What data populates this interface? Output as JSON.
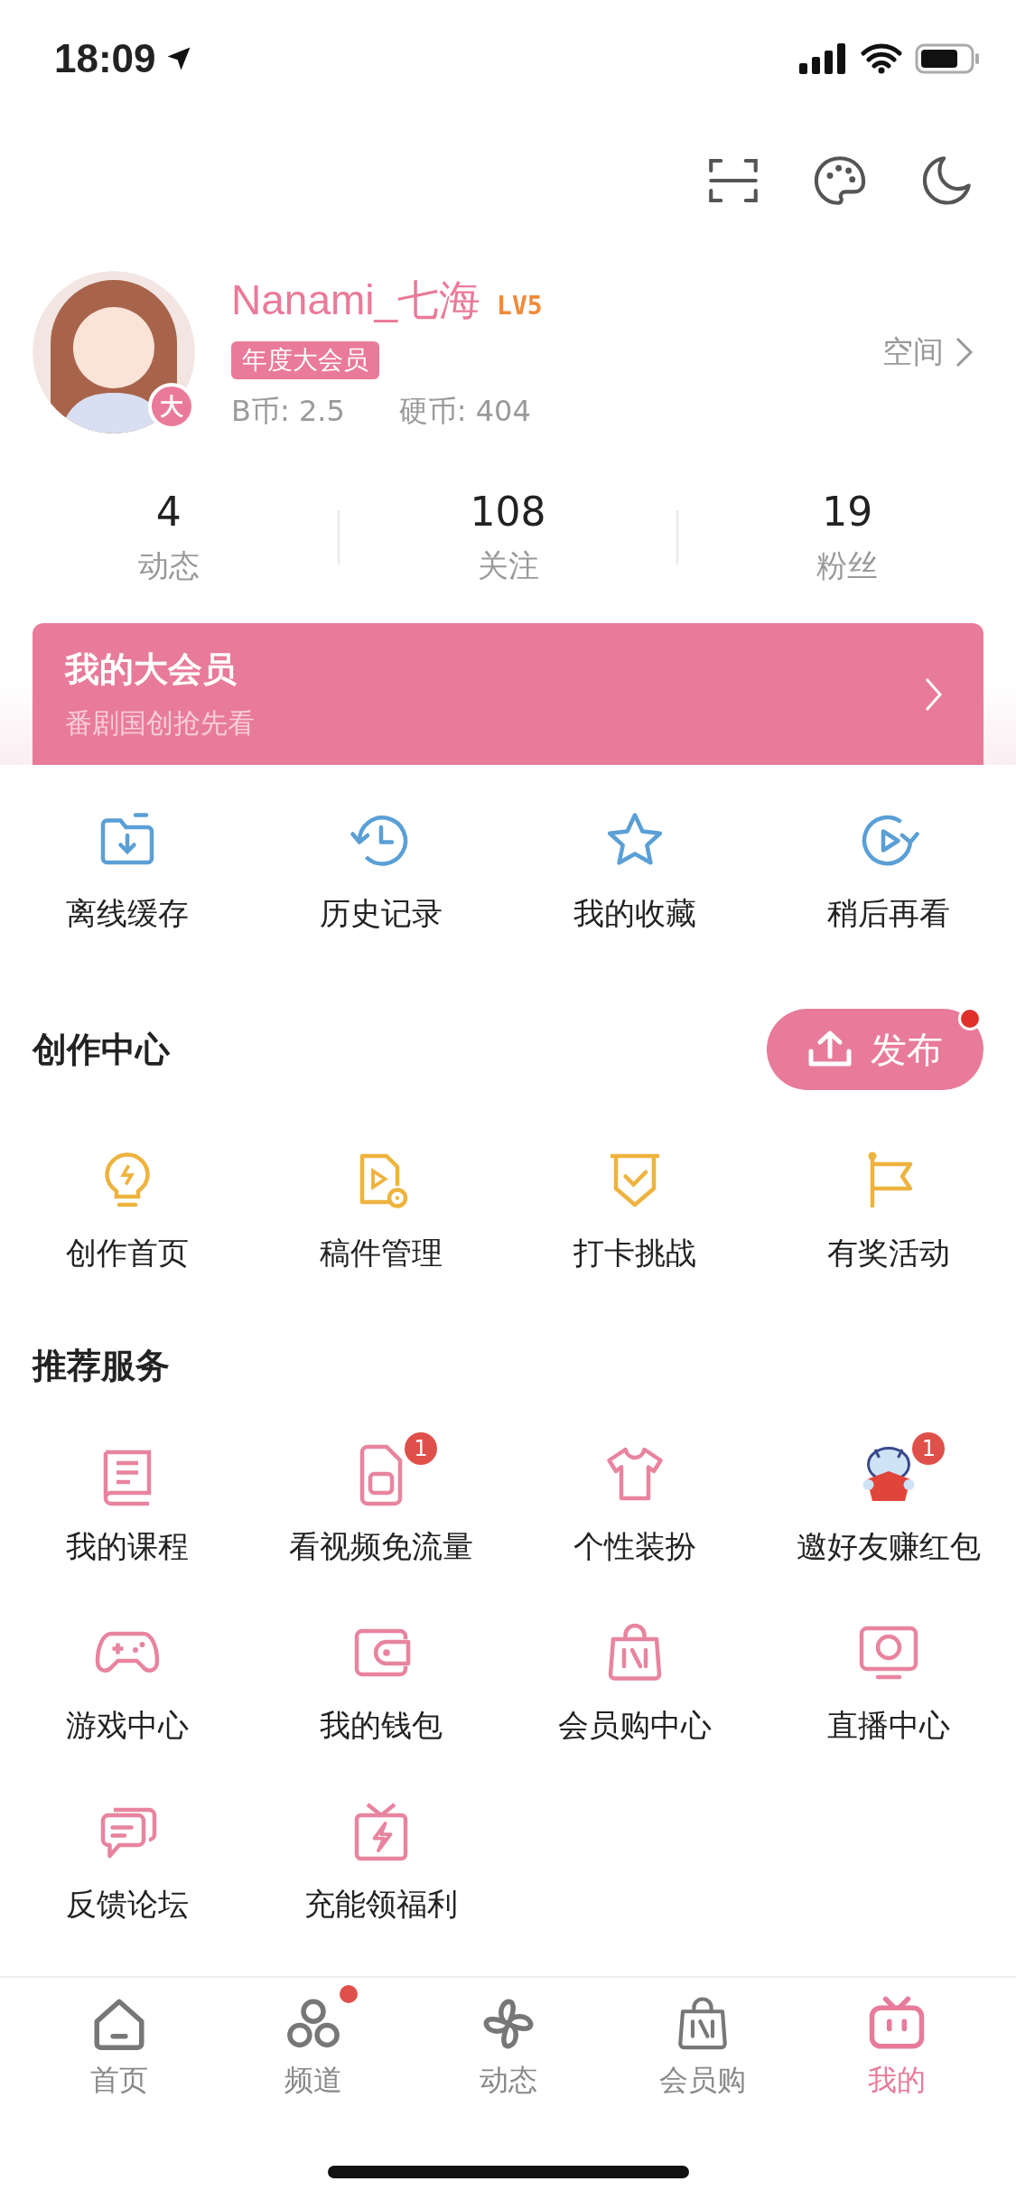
{
  "status_bar": {
    "time": "18:09"
  },
  "toolbar": [
    {
      "kind": "scan"
    },
    {
      "kind": "palette"
    },
    {
      "kind": "moon"
    }
  ],
  "profile": {
    "name": "Nanami_七海",
    "level": "LV5",
    "vip_tag": "年度大会员",
    "avatar_badge": "大",
    "b_coins": "B币: 2.5",
    "coins": "硬币: 404",
    "space_link": "空间"
  },
  "stats": [
    {
      "value": "4",
      "label": "动态"
    },
    {
      "value": "108",
      "label": "关注"
    },
    {
      "value": "19",
      "label": "粉丝"
    }
  ],
  "vip_banner": {
    "title": "我的大会员",
    "subtitle": "番剧国创抢先看"
  },
  "quick_actions": [
    {
      "kind": "download",
      "label": "离线缓存"
    },
    {
      "kind": "history",
      "label": "历史记录"
    },
    {
      "kind": "star",
      "label": "我的收藏"
    },
    {
      "kind": "later",
      "label": "稍后再看"
    }
  ],
  "creator_center": {
    "title": "创作中心",
    "publish_button": {
      "label": "发布",
      "has_dot": true
    },
    "items": [
      {
        "kind": "bulb",
        "label": "创作首页"
      },
      {
        "kind": "document",
        "label": "稿件管理"
      },
      {
        "kind": "shield",
        "label": "打卡挑战"
      },
      {
        "kind": "flag",
        "label": "有奖活动"
      }
    ]
  },
  "services": {
    "title": "推荐服务",
    "items": [
      {
        "kind": "book",
        "label": "我的课程"
      },
      {
        "kind": "sim",
        "label": "看视频免流量",
        "badge": "1"
      },
      {
        "kind": "shirt",
        "label": "个性装扮"
      },
      {
        "kind": "envelope",
        "label": "邀好友赚红包",
        "badge": "1"
      },
      {
        "kind": "gamepad",
        "label": "游戏中心"
      },
      {
        "kind": "wallet",
        "label": "我的钱包"
      },
      {
        "kind": "bag",
        "label": "会员购中心"
      },
      {
        "kind": "tv",
        "label": "直播中心"
      },
      {
        "kind": "chat",
        "label": "反馈论坛"
      },
      {
        "kind": "gift",
        "label": "充能领福利"
      }
    ]
  },
  "tab_bar": [
    {
      "kind": "home",
      "label": "首页",
      "selected": false,
      "has_dot": false
    },
    {
      "kind": "circles",
      "label": "频道",
      "selected": false,
      "has_dot": true
    },
    {
      "kind": "pinwheel",
      "label": "动态",
      "selected": false,
      "has_dot": false
    },
    {
      "kind": "bag",
      "label": "会员购",
      "selected": false,
      "has_dot": false
    },
    {
      "kind": "tvface",
      "label": "我的",
      "selected": true,
      "has_dot": false
    }
  ]
}
